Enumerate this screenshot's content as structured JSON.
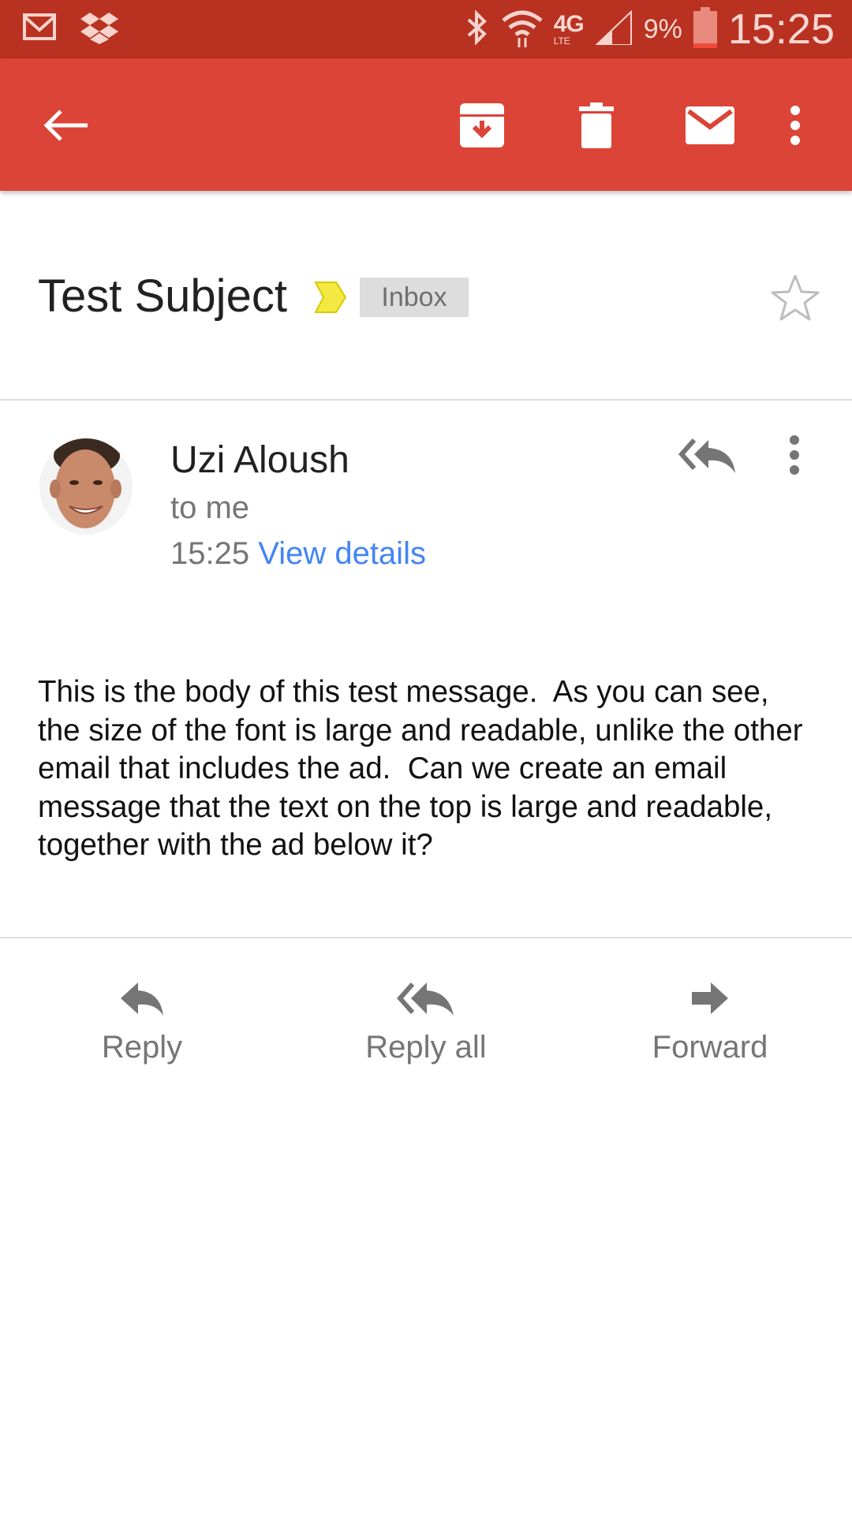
{
  "status_bar": {
    "network": "4G",
    "network_sub": "LTE",
    "battery_percent": "9%",
    "time": "15:25"
  },
  "app_bar": {
    "icons": [
      "back-arrow-icon",
      "archive-icon",
      "delete-icon",
      "mark-unread-icon",
      "more-vert-icon"
    ]
  },
  "email": {
    "subject": "Test Subject",
    "label": "Inbox",
    "sender_name": "Uzi Aloush",
    "recipient": "to me",
    "time": "15:25",
    "view_details": "View details",
    "body": "This is the body of this test message.  As you can see, the size of the font is large and readable, unlike the other email that includes the ad.  Can we create an email message that the text on the top is large and readable, together with the ad below it?"
  },
  "actions": {
    "reply": "Reply",
    "reply_all": "Reply all",
    "forward": "Forward"
  },
  "colors": {
    "status_bar": "#b93221",
    "app_bar": "#db4437",
    "link": "#4285f4",
    "label_marker": "#f4e842"
  }
}
